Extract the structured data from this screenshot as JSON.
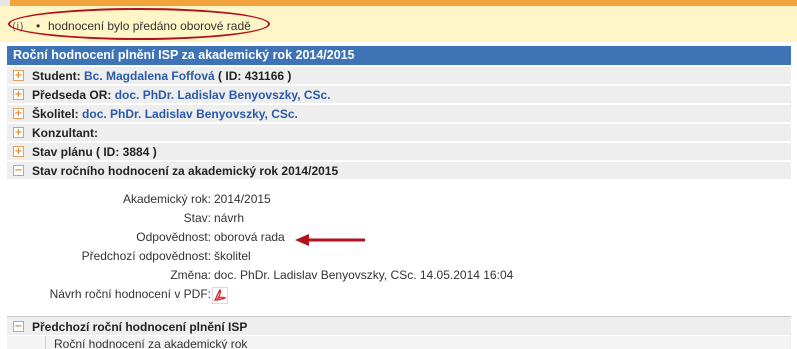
{
  "notice": {
    "icon": "info-icon",
    "glyph": "(i)",
    "bullet": "•",
    "message": "hodnocení bylo předáno oborové radě"
  },
  "panel": {
    "title": "Roční hodnocení plnění ISP za akademický rok 2014/2015"
  },
  "rows": {
    "student_label": "Student:",
    "student_name": "Bc. Magdalena Foffová",
    "student_id": "( ID: 431166 )",
    "predseda_label": "Předseda OR:",
    "predseda_name": "doc. PhDr. Ladislav Benyovszky, CSc.",
    "skolitel_label": "Školitel:",
    "skolitel_name": "doc. PhDr. Ladislav Benyovszky, CSc.",
    "konzultant_label": "Konzultant:",
    "stav_planu_label": "Stav plánu ( ID: 3884 )",
    "stav_rocniho_label": "Stav ročního hodnocení za akademický rok 2014/2015",
    "toggle_plus": "+",
    "toggle_minus": "−"
  },
  "details": {
    "akademicky_rok_label": "Akademický rok:",
    "akademicky_rok_value": "2014/2015",
    "stav_label": "Stav:",
    "stav_value": "návrh",
    "odpovednost_label": "Odpovědnost:",
    "odpovednost_value": "oborová rada",
    "predchozi_label": "Předchozí odpovědnost:",
    "predchozi_value": "školitel",
    "zmena_label": "Změna:",
    "zmena_value": "doc. PhDr. Ladislav Benyovszky, CSc. 14.05.2014 16:04",
    "pdf_label": "Návrh roční hodnocení v PDF:"
  },
  "previous": {
    "label": "Předchozí roční hodnocení plnění ISP",
    "item": "Roční hodnocení za akademický rok"
  },
  "colors": {
    "accent_orange": "#f1a33c",
    "panel_blue": "#3e74b5",
    "link_blue": "#2a5aa8",
    "annotation_red": "#b0111b"
  }
}
